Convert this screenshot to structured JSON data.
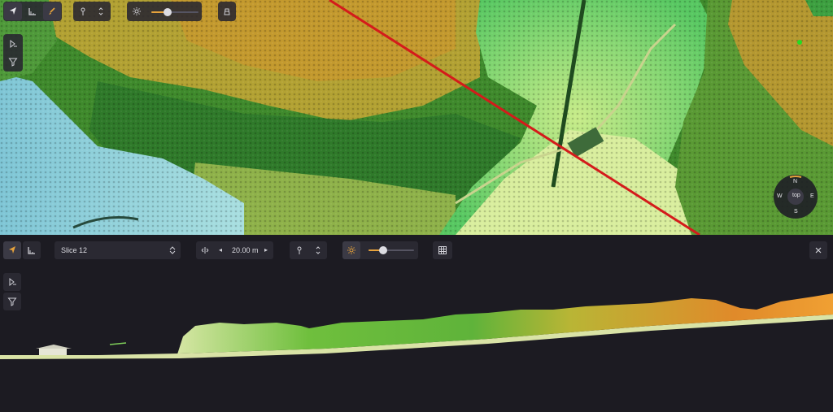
{
  "top_view": {
    "compass": {
      "north": "N",
      "south": "S",
      "east": "E",
      "west": "W",
      "center": "top"
    }
  },
  "profile_panel": {
    "slice_select": {
      "value": "Slice 12"
    },
    "width_value": "20.00 m"
  },
  "colors": {
    "accent": "#e6a23c",
    "section_line": "#d41b1b",
    "marker": "#22dd22"
  },
  "icons": [
    "navigate-icon",
    "measure-icon",
    "brush-icon",
    "point-info-icon",
    "lighting-icon",
    "slice-icon",
    "classify-icon",
    "filter-icon",
    "grid-icon",
    "close-icon",
    "dropdown-arrows-icon"
  ]
}
